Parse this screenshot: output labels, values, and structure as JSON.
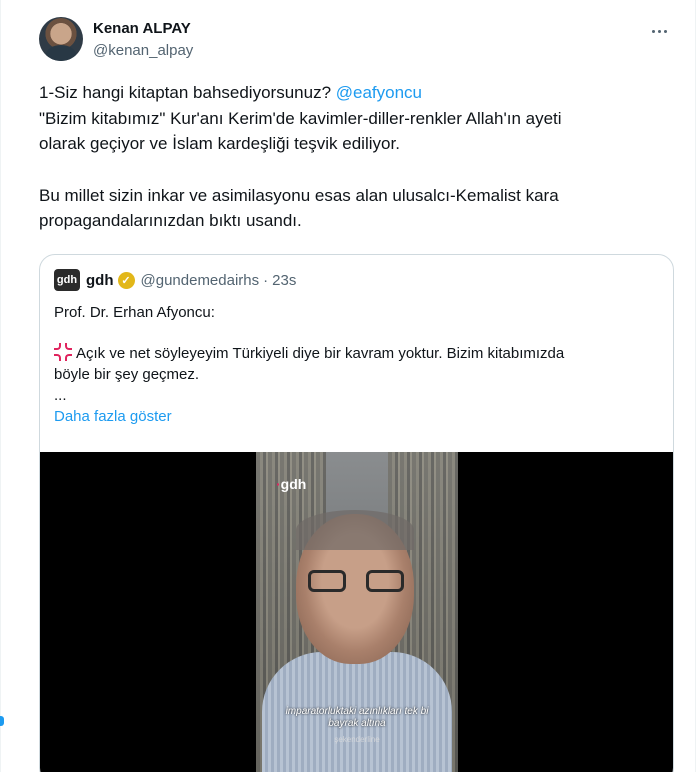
{
  "tweet": {
    "author": {
      "display_name": "Kenan ALPAY",
      "handle": "@kenan_alpay"
    },
    "text": {
      "line1_prefix": "1-Siz hangi kitaptan bahsediyorsunuz? ",
      "line1_mention": "@eafyoncu",
      "line2": "\"Bizim kitabımız\" Kur'anı Kerim'de kavimler-diller-renkler Allah'ın ayeti",
      "line3": "olarak geçiyor ve İslam kardeşliği teşvik ediliyor.",
      "line4": "Bu millet sizin inkar ve asimilasyonu esas alan ulusalcı-Kemalist kara",
      "line5": "propagandalarınızdan bıktı usandı."
    }
  },
  "quote": {
    "avatar_text": "gdh",
    "name": "gdh",
    "handle": "@gundemedairhs",
    "separator": "·",
    "time": "23s",
    "line1": "Prof. Dr. Erhan Afyoncu:",
    "line2": "Açık ve net söyleyeyim Türkiyeli diye bir kavram yoktur. Bizim kitabımızda",
    "line3": "böyle bir şey geçmez.",
    "ellipsis": "...",
    "show_more": "Daha fazla göster",
    "video": {
      "logo": "gdh",
      "caption_line1": "imparatorluktaki azınlıkları tek bi",
      "caption_line2": "bayrak altına",
      "caption_sub": "şekenderline"
    }
  },
  "colors": {
    "link": "#1d9bf0",
    "text": "#0f1419",
    "secondary": "#536471",
    "border": "#cfd9de",
    "verified": "#e2b719"
  },
  "icons": [
    "more-horizontal-icon",
    "verified-badge-icon",
    "anger-emoji-icon"
  ]
}
